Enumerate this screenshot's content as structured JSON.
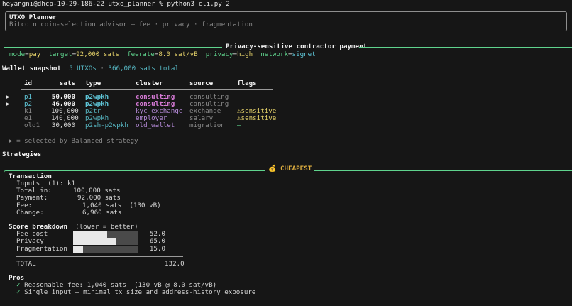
{
  "terminal": {
    "prompt": "heyangni@dhcp-10-29-186-22 utxo_planner % python3 cli.py 2"
  },
  "header": {
    "title": "UTXO Planner",
    "subtitle": "Bitcoin coin-selection advisor — fee · privacy · fragmentation"
  },
  "scenario": {
    "title": "Privacy-sensitive contractor payment",
    "mode_label": "mode",
    "mode_value": "pay",
    "target_label": "target",
    "target_value": "92,000 sats",
    "feerate_label": "feerate",
    "feerate_value": "8.0 sat/vB",
    "privacy_label": "privacy",
    "privacy_value": "high",
    "network_label": "network",
    "network_value": "signet"
  },
  "wallet": {
    "title": "Wallet snapshot",
    "utxo_count": "5 UTXOs",
    "total": "366,000 sats total",
    "columns": {
      "id": "id",
      "sats": "sats",
      "type": "type",
      "cluster": "cluster",
      "source": "source",
      "flags": "flags"
    },
    "rows": [
      {
        "marker": "▶",
        "id": "p1",
        "sats": "50,000",
        "type": "p2wpkh",
        "cluster": "consulting",
        "source": "consulting",
        "flags": "—"
      },
      {
        "marker": "▶",
        "id": "p2",
        "sats": "46,000",
        "type": "p2wpkh",
        "cluster": "consulting",
        "source": "consulting",
        "flags": "—"
      },
      {
        "marker": "",
        "id": "k1",
        "sats": "100,000",
        "type": "p2tr",
        "cluster": "kyc_exchange",
        "source": "exchange",
        "flags": "⚠sensitive"
      },
      {
        "marker": "",
        "id": "e1",
        "sats": "140,000",
        "type": "p2wpkh",
        "cluster": "employer",
        "source": "salary",
        "flags": "⚠sensitive"
      },
      {
        "marker": "",
        "id": "old1",
        "sats": "30,000",
        "type": "p2sh-p2wpkh",
        "cluster": "old_wallet",
        "source": "migration",
        "flags": "—"
      }
    ],
    "legend": "▶ = selected by Balanced strategy"
  },
  "strategies": {
    "title": "Strategies",
    "box_label": "CHEAPEST",
    "box_icon": "money-bag-icon",
    "transaction": {
      "title": "Transaction",
      "inputs_label": "Inputs",
      "inputs_value": "(1): k1",
      "total_in_label": "Total in:",
      "total_in_value": "100,000 sats",
      "payment_label": "Payment:",
      "payment_value": "92,000 sats",
      "fee_label": "Fee:",
      "fee_value": "1,040 sats",
      "fee_vb": "(130 vB)",
      "change_label": "Change:",
      "change_value": "6,960 sats"
    },
    "score": {
      "title": "Score breakdown",
      "subtitle": "(lower = better)",
      "items": [
        {
          "label": "Fee cost",
          "value": "52.0",
          "fraction": 0.52
        },
        {
          "label": "Privacy",
          "value": "65.0",
          "fraction": 0.65
        },
        {
          "label": "Fragmentation",
          "value": "15.0",
          "fraction": 0.15
        }
      ],
      "total_label": "TOTAL",
      "total_value": "132.0"
    },
    "pros": {
      "title": "Pros",
      "items": [
        "Reasonable fee: 1,040 sats  (130 vB @ 8.0 sat/vB)",
        "Single input — minimal tx size and address-history exposure"
      ]
    }
  }
}
